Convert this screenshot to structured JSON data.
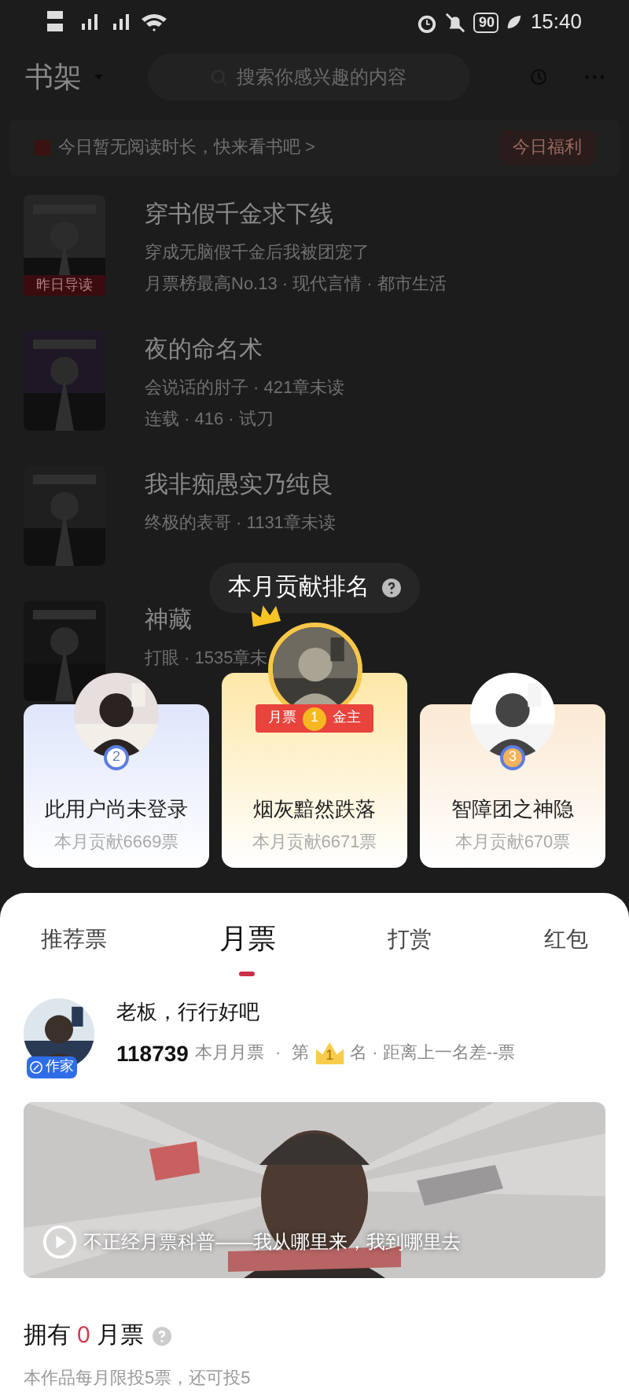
{
  "status_bar": {
    "battery": "90",
    "time": "15:40"
  },
  "header": {
    "title": "书架",
    "search": {
      "placeholder": "搜索你感兴趣的内容"
    }
  },
  "banner": {
    "text": "今日暂无阅读时长，快来看书吧 >",
    "button": "今日福利"
  },
  "books": [
    {
      "title": "穿书假千金求下线",
      "line_1": "穿成无脑假千金后我被团宠了",
      "line_2": "月票榜最高No.13 · 现代言情 · 都市生活",
      "badge": "昨日导读"
    },
    {
      "title": "夜的命名术",
      "line_1": "会说话的肘子 · 421章未读",
      "line_2": "连载 · 416 · 试刀"
    },
    {
      "title": "我非痴愚实乃纯良",
      "line_1": "终极的表哥 · 1131章未读"
    },
    {
      "title": "神藏",
      "line_1": "打眼 · 1535章未"
    }
  ],
  "ranking": {
    "title": "本月贡献排名",
    "entries": [
      {
        "name": "此用户尚未登录",
        "votes": "本月贡献6669票",
        "rank": "2",
        "kind": "side"
      },
      {
        "name": "烟灰黯然跌落",
        "votes": "本月贡献6671票",
        "rank": "1",
        "kind": "top",
        "ribbon_left": "月票",
        "ribbon_right": "金主"
      },
      {
        "name": "智障团之神隐",
        "votes": "本月贡献670票",
        "rank": "3",
        "kind": "side"
      }
    ]
  },
  "sheet": {
    "tabs": [
      {
        "label": "推荐票",
        "selected": false
      },
      {
        "label": "月票",
        "selected": true
      },
      {
        "label": "打赏",
        "selected": false
      },
      {
        "label": "红包",
        "selected": false
      }
    ],
    "author": {
      "badge": "作家",
      "message": "老板，行行好吧",
      "count": "118739",
      "count_label": "本月月票",
      "sep": "·",
      "rank_prefix": "第",
      "rank": "1",
      "rank_suffix": "名 · 距离上一名差--票"
    },
    "video": {
      "caption": "不正经月票科普——我从哪里来，我到哪里去"
    },
    "own": {
      "label": "拥有",
      "count": "0",
      "unit": "月票",
      "note": "本作品每月限投5票，还可投5"
    }
  }
}
